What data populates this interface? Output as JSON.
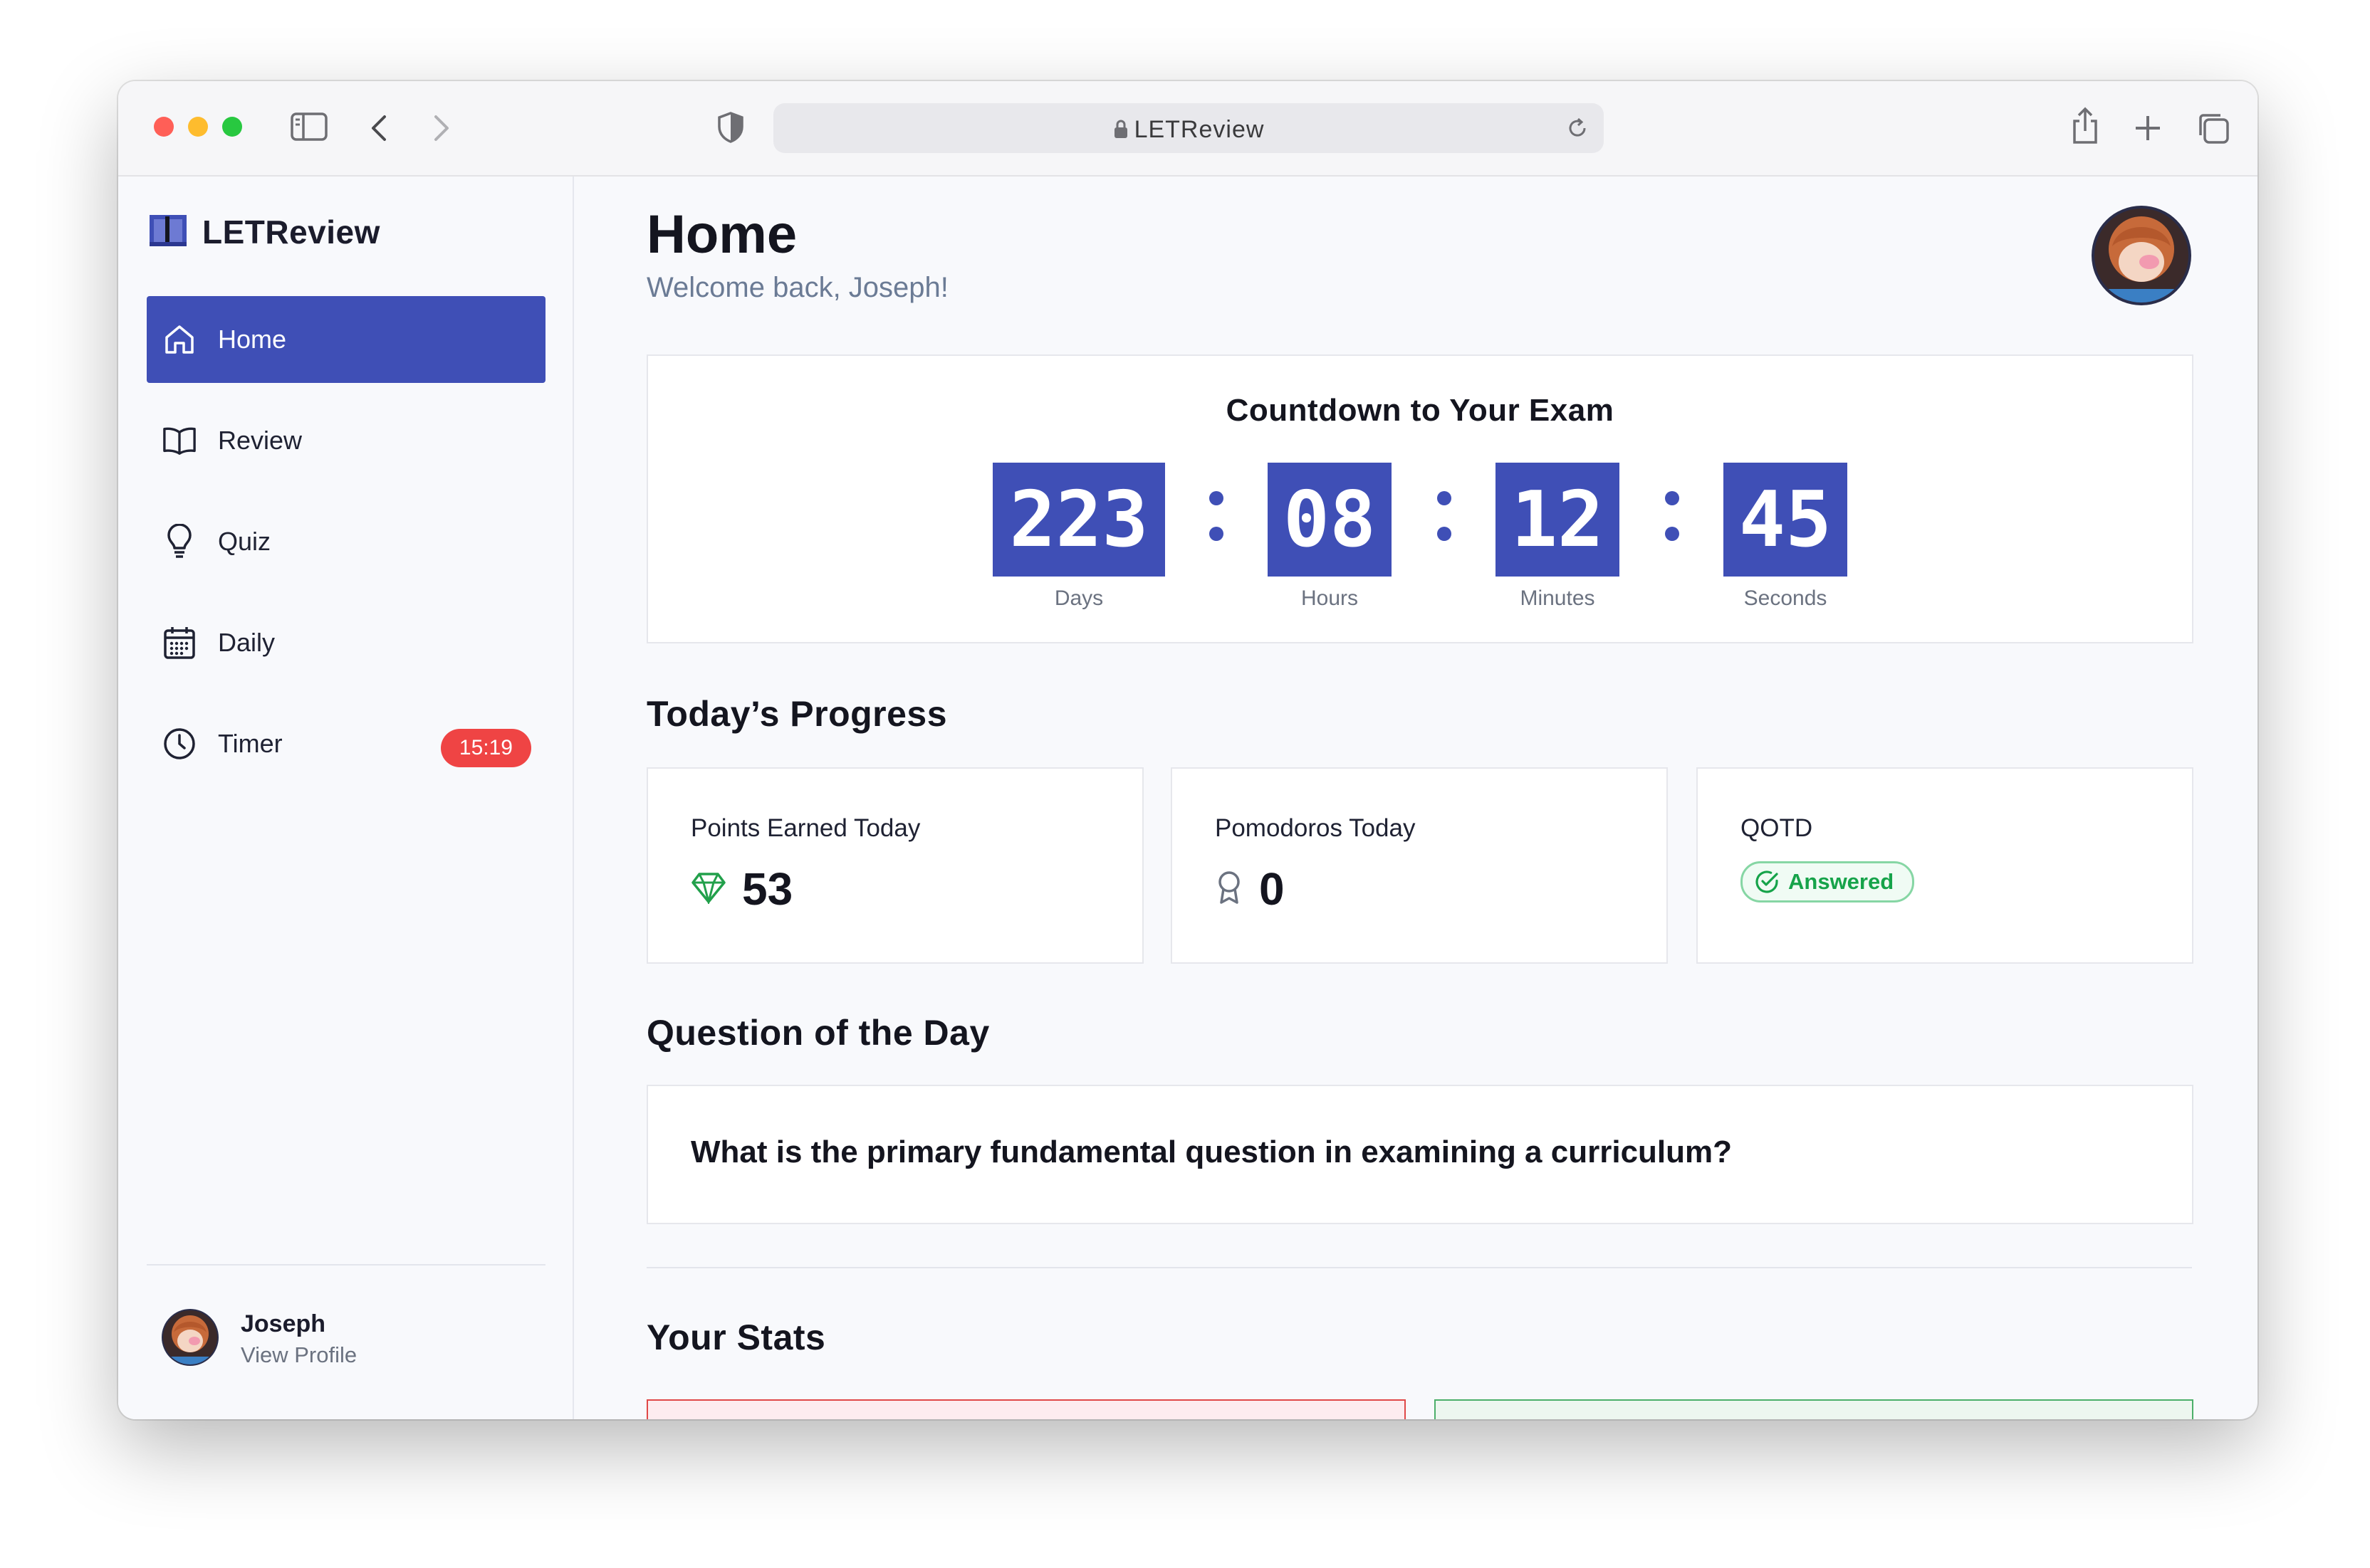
{
  "browser": {
    "url_text": "LETReview",
    "traffic_lights": {
      "close": "#ff5f57",
      "minimize": "#febc2e",
      "maximize": "#28c840"
    }
  },
  "sidebar": {
    "brand": "LETReview",
    "items": [
      {
        "label": "Home",
        "icon": "home-icon",
        "active": true
      },
      {
        "label": "Review",
        "icon": "book-open-icon",
        "active": false
      },
      {
        "label": "Quiz",
        "icon": "lightbulb-icon",
        "active": false
      },
      {
        "label": "Daily",
        "icon": "calendar-icon",
        "active": false
      },
      {
        "label": "Timer",
        "icon": "clock-icon",
        "active": false,
        "badge": "15:19"
      }
    ],
    "profile": {
      "name": "Joseph",
      "subtitle": "View Profile"
    }
  },
  "header": {
    "title": "Home",
    "subtitle": "Welcome back, Joseph!"
  },
  "countdown": {
    "title": "Countdown to Your Exam",
    "units": [
      {
        "value": "223",
        "label": "Days"
      },
      {
        "value": "08",
        "label": "Hours"
      },
      {
        "value": "12",
        "label": "Minutes"
      },
      {
        "value": "45",
        "label": "Seconds"
      }
    ]
  },
  "progress": {
    "title": "Today’s Progress",
    "cards": [
      {
        "label": "Points Earned Today",
        "value": "53",
        "icon": "gem-icon"
      },
      {
        "label": "Pomodoros Today",
        "value": "0",
        "icon": "award-icon"
      },
      {
        "label": "QOTD",
        "status": "Answered",
        "icon": "check-circle-icon"
      }
    ]
  },
  "qotd": {
    "title": "Question of the Day",
    "question": "What is the primary fundamental question in examining a curriculum?"
  },
  "stats": {
    "title": "Your Stats"
  },
  "colors": {
    "accent": "#3f4fb6",
    "badge_red": "#ef4444",
    "success_green": "#16a34a"
  }
}
